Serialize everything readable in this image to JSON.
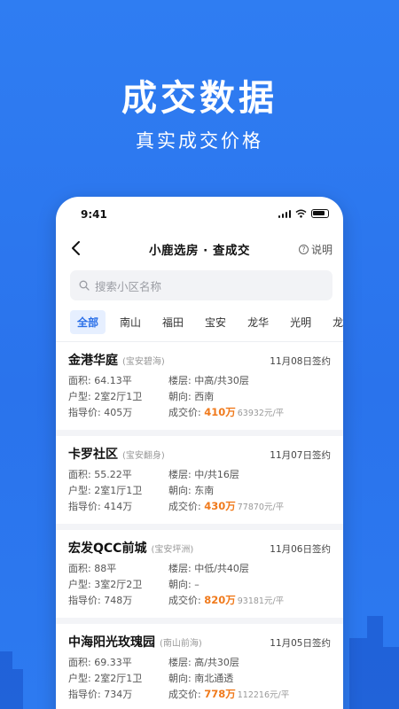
{
  "hero": {
    "title": "成交数据",
    "subtitle": "真实成交价格"
  },
  "status_bar": {
    "time": "9:41"
  },
  "nav": {
    "title": "小鹿选房 · 查成交",
    "help_label": "说明"
  },
  "search": {
    "placeholder": "搜索小区名称"
  },
  "tabs": [
    {
      "label": "全部",
      "active": true
    },
    {
      "label": "南山"
    },
    {
      "label": "福田"
    },
    {
      "label": "宝安"
    },
    {
      "label": "龙华"
    },
    {
      "label": "光明"
    },
    {
      "label": "龙"
    }
  ],
  "colors": {
    "accent": "#2a6fe8",
    "background": "#2d79f0",
    "price": "#f07a1c"
  },
  "records": [
    {
      "name": "金港华庭",
      "district": "(宝安碧海)",
      "date": "11月08日签约",
      "area": "面积: 64.13平",
      "floor": "楼层: 中高/共30层",
      "layout": "户型: 2室2厅1卫",
      "orientation": "朝向: 西南",
      "guide_price": "指导价: 405万",
      "deal_label": "成交价:",
      "deal_price": "410万",
      "unit_price": "63932元/平"
    },
    {
      "name": "卡罗社区",
      "district": "(宝安翻身)",
      "date": "11月07日签约",
      "area": "面积: 55.22平",
      "floor": "楼层: 中/共16层",
      "layout": "户型: 2室1厅1卫",
      "orientation": "朝向: 东南",
      "guide_price": "指导价: 414万",
      "deal_label": "成交价:",
      "deal_price": "430万",
      "unit_price": "77870元/平"
    },
    {
      "name": "宏发QCC前城",
      "district": "(宝安坪洲)",
      "date": "11月06日签约",
      "area": "面积: 88平",
      "floor": "楼层: 中低/共40层",
      "layout": "户型: 3室2厅2卫",
      "orientation": "朝向: –",
      "guide_price": "指导价: 748万",
      "deal_label": "成交价:",
      "deal_price": "820万",
      "unit_price": "93181元/平"
    },
    {
      "name": "中海阳光玫瑰园",
      "district": "(南山前海)",
      "date": "11月05日签约",
      "area": "面积: 69.33平",
      "floor": "楼层: 高/共30层",
      "layout": "户型: 2室2厅1卫",
      "orientation": "朝向: 南北通透",
      "guide_price": "指导价: 734万",
      "deal_label": "成交价:",
      "deal_price": "778万",
      "unit_price": "112216元/平"
    }
  ]
}
